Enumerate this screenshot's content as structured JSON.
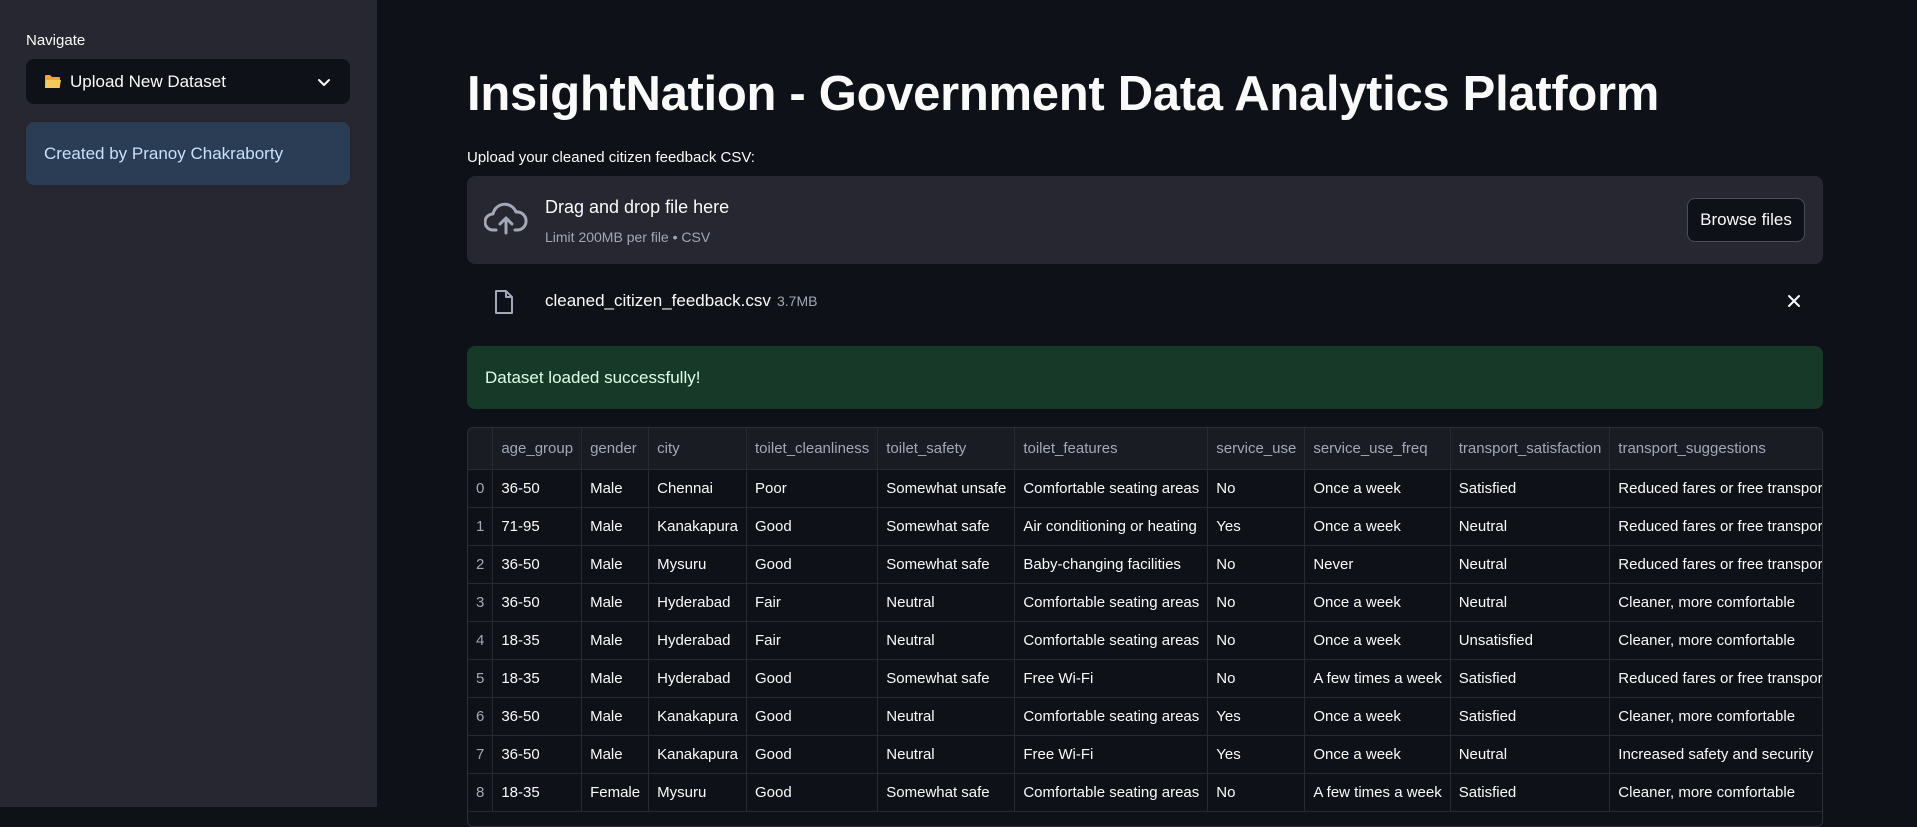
{
  "sidebar": {
    "nav_label": "Navigate",
    "nav_selected": "Upload New Dataset",
    "nav_icon": "folder-icon",
    "info_text": "Created by Pranoy Chakraborty"
  },
  "main": {
    "title": "InsightNation - Government Data Analytics Platform",
    "upload_label": "Upload your cleaned citizen feedback CSV:",
    "dropzone": {
      "title": "Drag and drop file here",
      "subtitle": "Limit 200MB per file • CSV",
      "browse_label": "Browse files"
    },
    "file": {
      "name": "cleaned_citizen_feedback.csv",
      "size": "3.7MB"
    },
    "success_message": "Dataset loaded successfully!"
  },
  "table": {
    "columns": [
      "",
      "age_group",
      "gender",
      "city",
      "toilet_cleanliness",
      "toilet_safety",
      "toilet_features",
      "service_use",
      "service_use_freq",
      "transport_satisfaction",
      "transport_suggestions"
    ],
    "rows": [
      [
        "0",
        "36-50",
        "Male",
        "Chennai",
        "Poor",
        "Somewhat unsafe",
        "Comfortable seating areas",
        "No",
        "Once a week",
        "Satisfied",
        "Reduced fares or free transport"
      ],
      [
        "1",
        "71-95",
        "Male",
        "Kanakapura",
        "Good",
        "Somewhat safe",
        "Air conditioning or heating",
        "Yes",
        "Once a week",
        "Neutral",
        "Reduced fares or free transport"
      ],
      [
        "2",
        "36-50",
        "Male",
        "Mysuru",
        "Good",
        "Somewhat safe",
        "Baby-changing facilities",
        "No",
        "Never",
        "Neutral",
        "Reduced fares or free transport"
      ],
      [
        "3",
        "36-50",
        "Male",
        "Hyderabad",
        "Fair",
        "Neutral",
        "Comfortable seating areas",
        "No",
        "Once a week",
        "Neutral",
        "Cleaner, more comfortable"
      ],
      [
        "4",
        "18-35",
        "Male",
        "Hyderabad",
        "Fair",
        "Neutral",
        "Comfortable seating areas",
        "No",
        "Once a week",
        "Unsatisfied",
        "Cleaner, more comfortable"
      ],
      [
        "5",
        "18-35",
        "Male",
        "Hyderabad",
        "Good",
        "Somewhat safe",
        "Free Wi-Fi",
        "No",
        "A few times a week",
        "Satisfied",
        "Reduced fares or free transport"
      ],
      [
        "6",
        "36-50",
        "Male",
        "Kanakapura",
        "Good",
        "Neutral",
        "Comfortable seating areas",
        "Yes",
        "Once a week",
        "Satisfied",
        "Cleaner, more comfortable"
      ],
      [
        "7",
        "36-50",
        "Male",
        "Kanakapura",
        "Good",
        "Neutral",
        "Free Wi-Fi",
        "Yes",
        "Once a week",
        "Neutral",
        "Increased safety and security"
      ],
      [
        "8",
        "18-35",
        "Female",
        "Mysuru",
        "Good",
        "Somewhat safe",
        "Comfortable seating areas",
        "No",
        "A few times a week",
        "Satisfied",
        "Cleaner, more comfortable"
      ]
    ]
  }
}
